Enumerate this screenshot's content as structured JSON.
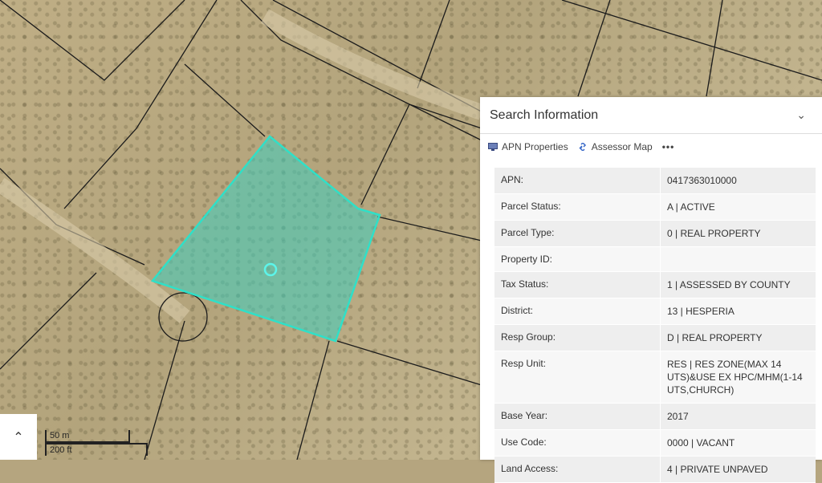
{
  "panel": {
    "title": "Search Information",
    "tools": {
      "apn_properties": "APN Properties",
      "assessor_map": "Assessor Map",
      "more": "•••"
    },
    "rows": [
      {
        "key": "APN:",
        "value": "0417363010000"
      },
      {
        "key": "Parcel Status:",
        "value": "A | ACTIVE"
      },
      {
        "key": "Parcel Type:",
        "value": "0 | REAL PROPERTY"
      },
      {
        "key": "Property ID:",
        "value": ""
      },
      {
        "key": "Tax Status:",
        "value": "1 | ASSESSED BY COUNTY"
      },
      {
        "key": "District:",
        "value": "13 | HESPERIA"
      },
      {
        "key": "Resp Group:",
        "value": "D | REAL PROPERTY"
      },
      {
        "key": "Resp Unit:",
        "value": "RES | RES ZONE(MAX 14 UTS)&USE EX HPC/MHM(1-14 UTS,CHURCH)"
      },
      {
        "key": "Base Year:",
        "value": "2017"
      },
      {
        "key": "Use Code:",
        "value": "0000 | VACANT"
      },
      {
        "key": "Land Access:",
        "value": "4 | PRIVATE UNPAVED"
      }
    ]
  },
  "scale": {
    "meters": "50 m",
    "feet": "200 ft"
  },
  "icons": {
    "expand": "chevron-up-icon",
    "collapse": "chevron-down-icon"
  },
  "colors": {
    "parcel_fill": "#3ecfc0",
    "parcel_stroke": "#2fe0c8"
  }
}
